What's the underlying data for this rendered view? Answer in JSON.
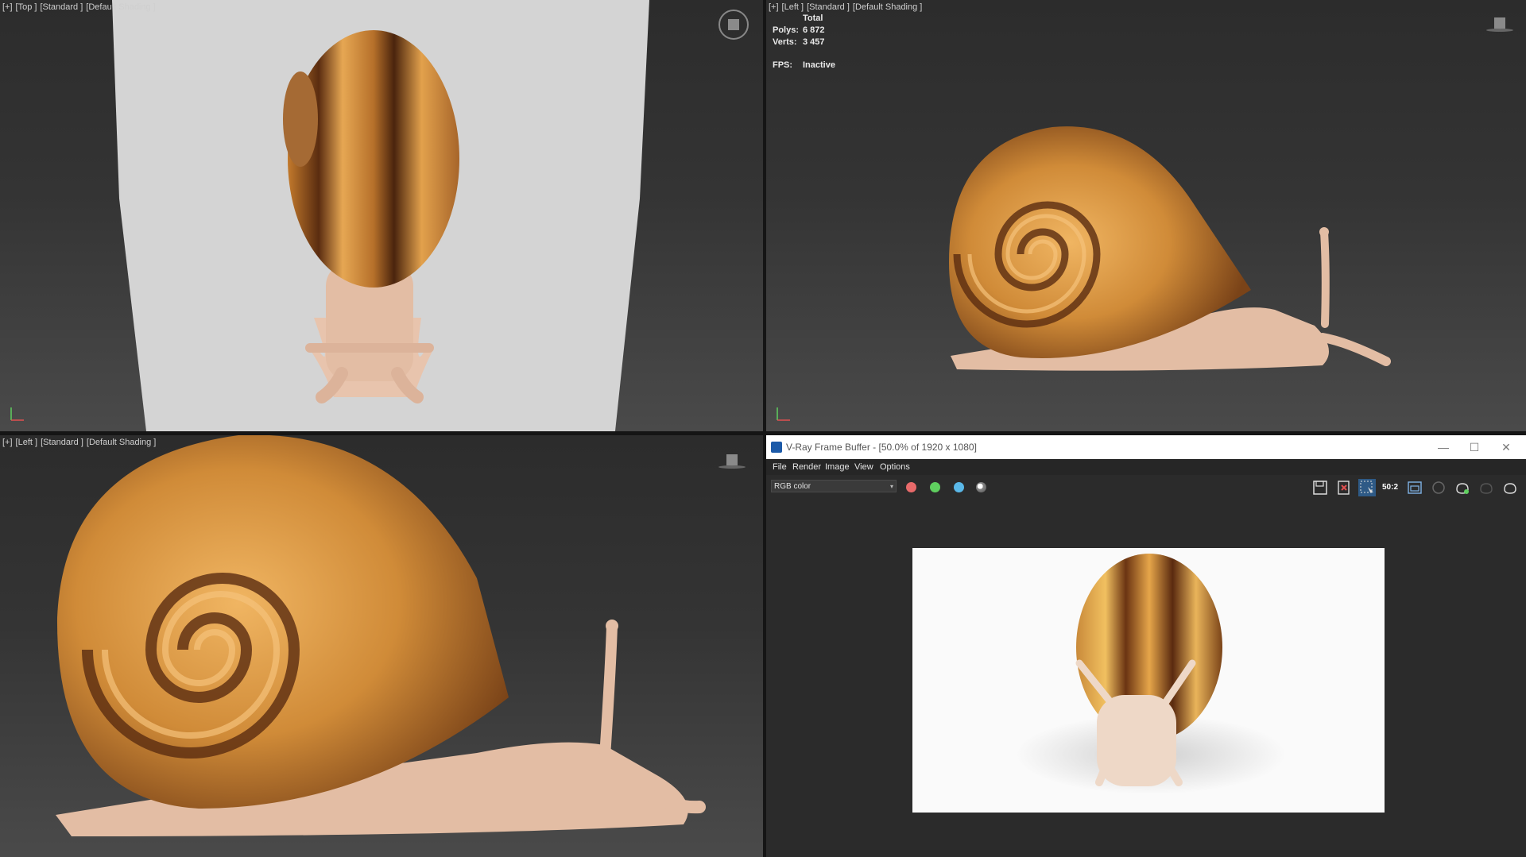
{
  "viewports": {
    "top_left": {
      "label_parts": [
        "[+]",
        "[Top ]",
        "[Standard ]",
        "[Default Shading ]"
      ]
    },
    "top_right": {
      "label_parts": [
        "[+]",
        "[Left ]",
        "[Standard ]",
        "[Default Shading ]"
      ],
      "stats": {
        "header": "Total",
        "polys_label": "Polys:",
        "polys_value": "6 872",
        "verts_label": "Verts:",
        "verts_value": "3 457",
        "fps_label": "FPS:",
        "fps_value": "Inactive"
      }
    },
    "bottom_left": {
      "label_parts": [
        "[+]",
        "[Left ]",
        "[Standard ]",
        "[Default Shading ]"
      ]
    }
  },
  "vfb": {
    "title": "V-Ray Frame Buffer - [50.0% of 1920 x 1080]",
    "window_buttons": [
      "—",
      "☐",
      "✕"
    ],
    "menu": [
      "File",
      "Render",
      "Image",
      "View",
      "Options"
    ],
    "channel_select": "RGB color",
    "channel_colors": {
      "red": "#e86a6a",
      "green": "#5fcf5f",
      "blue": "#5ab8e8"
    },
    "zoom_label": "50:2",
    "toolbar_icons": [
      "save-icon",
      "clear-icon",
      "region-select-icon",
      "zoom-icon",
      "track-mouse-icon",
      "stop-render-icon",
      "render-teapot-icon",
      "render-interactive-icon",
      "render-last-icon"
    ]
  },
  "colors": {
    "shell_light": "#e0a24a",
    "shell_dark": "#6b3a17",
    "body": "#e8c4ad",
    "accent": "#1c5aa8"
  }
}
